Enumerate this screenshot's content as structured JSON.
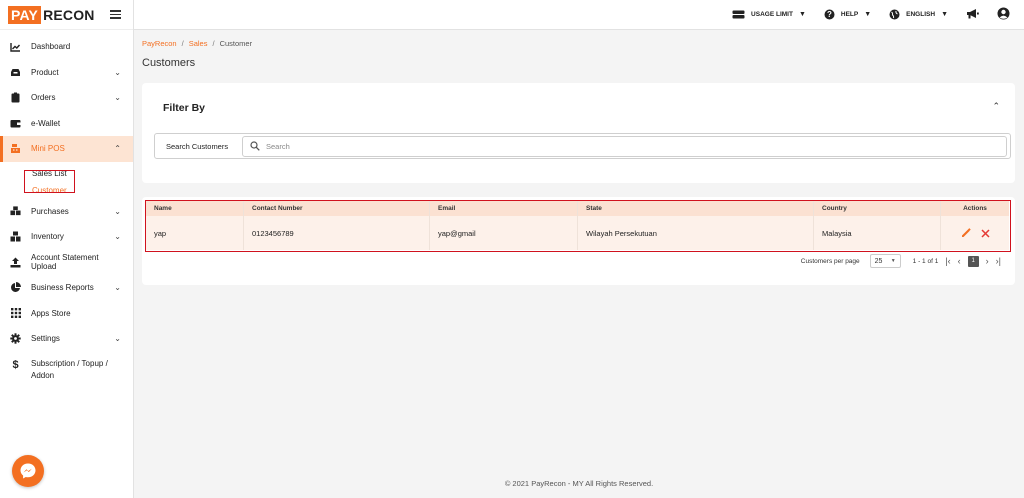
{
  "logo": {
    "pay": "PAY",
    "recon": "RECON"
  },
  "sidebar": {
    "items": [
      {
        "label": "Dashboard",
        "icon": "chart-line-icon"
      },
      {
        "label": "Product",
        "icon": "inbox-icon"
      },
      {
        "label": "Orders",
        "icon": "clipboard-icon"
      },
      {
        "label": "e-Wallet",
        "icon": "wallet-icon"
      },
      {
        "label": "Mini POS",
        "icon": "cash-register-icon"
      },
      {
        "label": "Purchases",
        "icon": "boxes-icon"
      },
      {
        "label": "Inventory",
        "icon": "stack-boxes-icon"
      },
      {
        "label": "Account Statement Upload",
        "icon": "upload-icon"
      },
      {
        "label": "Business Reports",
        "icon": "pie-chart-icon"
      },
      {
        "label": "Apps Store",
        "icon": "grid-icon"
      },
      {
        "label": "Settings",
        "icon": "gear-icon"
      },
      {
        "label": "Subscription / Topup / Addon",
        "icon": "dollar-icon"
      }
    ],
    "mini_pos_sub": [
      {
        "label": "Sales List"
      },
      {
        "label": "Customer"
      }
    ]
  },
  "topbar": {
    "usage_limit": "USAGE LIMIT",
    "help": "HELP",
    "language": "ENGLISH"
  },
  "breadcrumb": {
    "root": "PayRecon",
    "section": "Sales",
    "current": "Customer"
  },
  "page_title": "Customers",
  "filter": {
    "title": "Filter By",
    "search_label": "Search Customers",
    "search_placeholder": "Search",
    "search_value": ""
  },
  "table": {
    "headers": [
      "Name",
      "Contact Number",
      "Email",
      "State",
      "Country",
      "Actions"
    ],
    "rows": [
      [
        "yap",
        "0123456789",
        "yap@gmail",
        "Wilayah Persekutuan",
        "Malaysia"
      ]
    ]
  },
  "pagination": {
    "per_page_label": "Customers per page",
    "per_page_value": "25",
    "range": "1 - 1 of 1",
    "current_page": "1"
  },
  "footer": "© 2021 PayRecon - MY All Rights Reserved.",
  "colors": {
    "accent": "#f36f21",
    "highlight_border": "#d0121e",
    "delete": "#e53935"
  }
}
